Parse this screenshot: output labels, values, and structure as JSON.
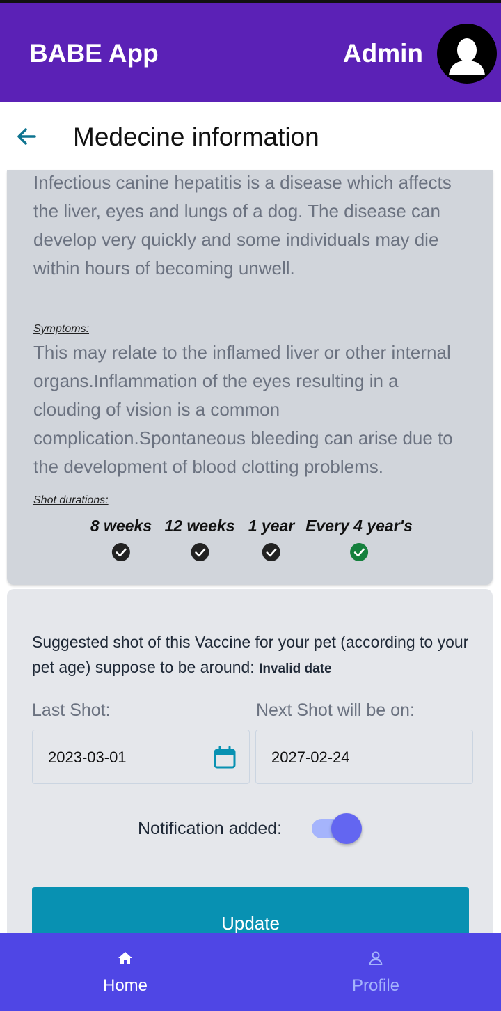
{
  "app": {
    "title": "BABE App",
    "user_label": "Admin"
  },
  "page": {
    "title": "Medecine information"
  },
  "info": {
    "description": "Infectious canine hepatitis is a disease which affects the liver, eyes and lungs of a dog. The disease can develop very quickly and some individuals may die within hours of becoming unwell.",
    "symptoms_label": "Symptoms:",
    "symptoms": "This may relate to the inflamed liver or other internal organs.Inflammation of the eyes resulting in a clouding of vision is a common complication.Spontaneous bleeding can arise due to the development of blood clotting problems.",
    "durations_label": "Shot durations:",
    "durations": [
      {
        "label": "8 weeks",
        "done": true,
        "color": "#222222"
      },
      {
        "label": "12 weeks",
        "done": true,
        "color": "#222222"
      },
      {
        "label": "1 year",
        "done": true,
        "color": "#222222"
      },
      {
        "label": "Every 4 year's",
        "done": true,
        "color": "#15803d"
      }
    ]
  },
  "form": {
    "suggestion_text": "Suggested shot of this Vaccine for your pet (according to your pet age) suppose to be around: ",
    "suggestion_date": "Invalid date",
    "last_shot_label": "Last Shot:",
    "last_shot_value": "2023-03-01",
    "next_shot_label": "Next Shot will be on:",
    "next_shot_value": "2027-02-24",
    "notification_label": "Notification added:",
    "notification_on": true,
    "update_label": "Update"
  },
  "nav": {
    "home_label": "Home",
    "profile_label": "Profile"
  },
  "colors": {
    "header": "#5b21b6",
    "accent": "#0891b2",
    "nav": "#4f46e5",
    "toggle": "#6366f1"
  }
}
